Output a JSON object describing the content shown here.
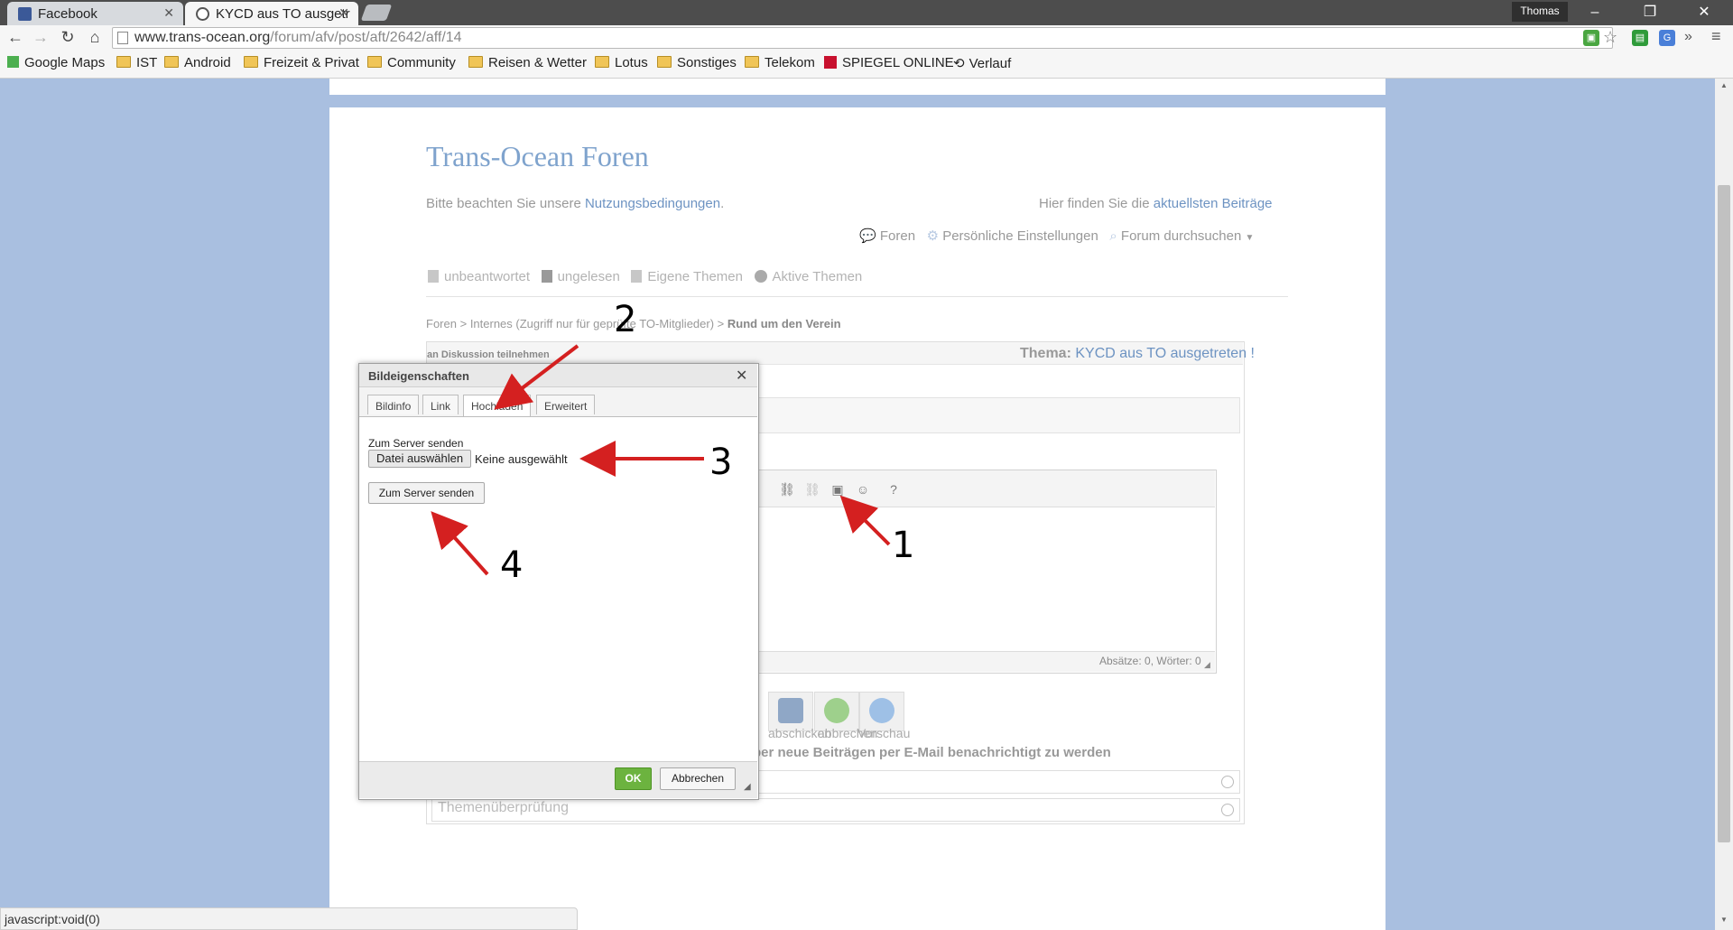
{
  "browser": {
    "tabs": [
      {
        "label": "Facebook",
        "active": false
      },
      {
        "label": "KYCD aus TO ausgetr",
        "active": true
      }
    ],
    "user": "Thomas",
    "url_host": "www.trans-ocean.org",
    "url_path": "/forum/afv/post/aft/2642/aff/14",
    "bookmarks": [
      "Google Maps",
      "IST",
      "Android",
      "Freizeit & Privat",
      "Community",
      "Reisen & Wetter",
      "Lotus",
      "Sonstiges",
      "Telekom",
      "SPIEGEL ONLINE",
      "Verlauf"
    ],
    "status_text": "javascript:void(0)"
  },
  "site": {
    "title": "Trans-Ocean Foren",
    "notice_prefix": "Bitte beachten Sie unsere ",
    "notice_link": "Nutzungsbedingungen",
    "notice_suffix": ".",
    "latest_prefix": "Hier finden Sie die ",
    "latest_link": "aktuellsten Beiträge",
    "menu": [
      "Foren",
      "Persönliche Einstellungen",
      "Forum durchsuchen"
    ],
    "quicklinks": [
      "unbeantwortet",
      "ungelesen",
      "Eigene Themen",
      "Aktive Themen"
    ],
    "breadcrumb": {
      "items": [
        "Foren",
        "Internes (Zugriff nur für geprüfte TO-Mitglieder)"
      ],
      "separator": ">",
      "current": "Rund um den Verein"
    }
  },
  "post": {
    "join_label": "an Diskussion teilnehmen",
    "thema_label": "Thema:",
    "thema_value": "KYCD aus TO ausgetreten !",
    "wordcount": "Absätze: 0, Wörter: 0",
    "action_buttons": [
      "abschicken",
      "abbrechen",
      "Vorschau"
    ],
    "notify_text": "ber neue Beiträgen per E-Mail benachrichtigt zu werden",
    "accordion_label": "Themenüberprüfung"
  },
  "dialog": {
    "title": "Bildeigenschaften",
    "tabs": [
      "Bildinfo",
      "Link",
      "Hochladen",
      "Erweitert"
    ],
    "selected_tab": "Hochladen",
    "upload_label": "Zum Server senden",
    "file_button": "Datei auswählen",
    "file_status": "Keine ausgewählt",
    "send_button": "Zum Server senden",
    "ok_label": "OK",
    "cancel_label": "Abbrechen"
  },
  "annotations": [
    "1",
    "2",
    "3",
    "4"
  ],
  "colors": {
    "page_bg": "#a9bfe0",
    "title_blue": "#7fa3cd",
    "link_blue": "#6d93c2",
    "ok_green": "#6cb33f",
    "annotation_red": "#d42020"
  }
}
